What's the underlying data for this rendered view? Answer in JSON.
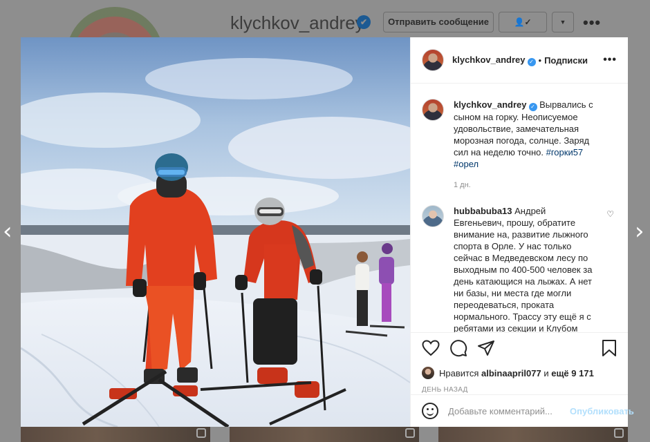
{
  "background": {
    "username": "klychkov_andrey",
    "verified_glyph": "✔",
    "send_message_label": "Отправить сообщение",
    "following_label": "👤✓",
    "dropdown_glyph": "▼",
    "more_glyph": "•••"
  },
  "nav": {
    "prev_glyph": "‹",
    "next_glyph": "›"
  },
  "post": {
    "header": {
      "username": "klychkov_andrey",
      "dot": "•",
      "follow_label": "Подписки",
      "more_glyph": "•••"
    },
    "caption": {
      "username": "klychkov_andrey",
      "text": "Вырвались с сыном на горку. Неописуемое удовольствие, замечательная морозная погода, солнце. Заряд сил на неделю точно.",
      "tags": [
        "#горки57",
        "#орел"
      ],
      "time": "1 дн."
    },
    "comments": [
      {
        "username": "hubbabuba13",
        "text": "Андрей Евгеньевич, прошу, обратите внимание на, развитие лыжного спорта в Орле. У нас только сейчас в Медведевском лесу по выходным по 400-500 человек за день катающися на лыжах. А нет ни базы, ни места где могли переодеваться, проката нормального. Трассу эту ещё я с ребятами из секции и Клубом любителей лыж"
      }
    ],
    "likes": {
      "prefix": "Нравится",
      "user": "albinaapril077",
      "middle": "и",
      "others": "ещё 9 171"
    },
    "date": "ДЕНЬ НАЗАД",
    "add_comment": {
      "placeholder": "Добавьте комментарий...",
      "publish_label": "Опубликовать"
    },
    "icons": [
      "heart-icon",
      "comment-icon",
      "share-icon",
      "bookmark-icon",
      "emoji-icon"
    ],
    "colors": {
      "link": "#00376b",
      "verified": "#3897f0",
      "publish_disabled": "#b2dffc",
      "jacket": "#e2401f"
    }
  }
}
